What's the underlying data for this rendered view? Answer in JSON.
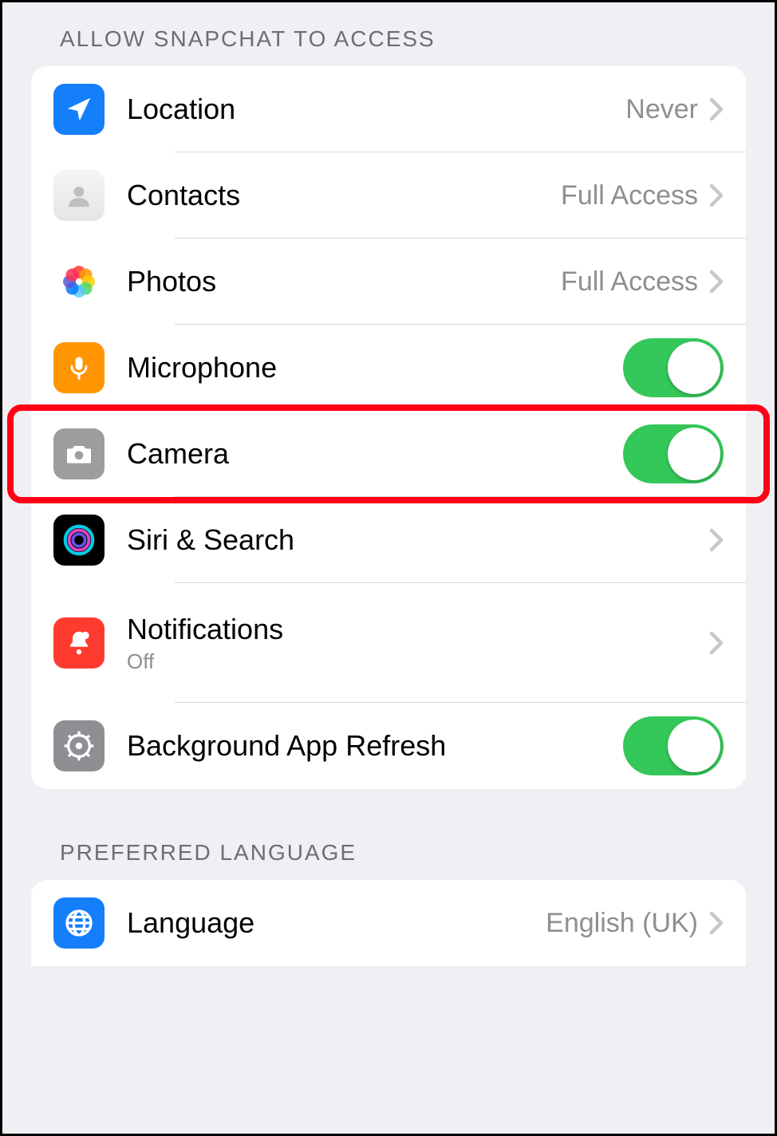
{
  "sections": {
    "access_header": "ALLOW SNAPCHAT TO ACCESS",
    "lang_header": "PREFERRED LANGUAGE"
  },
  "rows": {
    "location": {
      "label": "Location",
      "value": "Never"
    },
    "contacts": {
      "label": "Contacts",
      "value": "Full Access"
    },
    "photos": {
      "label": "Photos",
      "value": "Full Access"
    },
    "microphone": {
      "label": "Microphone"
    },
    "camera": {
      "label": "Camera"
    },
    "siri": {
      "label": "Siri & Search"
    },
    "notifications": {
      "label": "Notifications",
      "sub": "Off"
    },
    "bgrefresh": {
      "label": "Background App Refresh"
    },
    "language": {
      "label": "Language",
      "value": "English (UK)"
    }
  }
}
